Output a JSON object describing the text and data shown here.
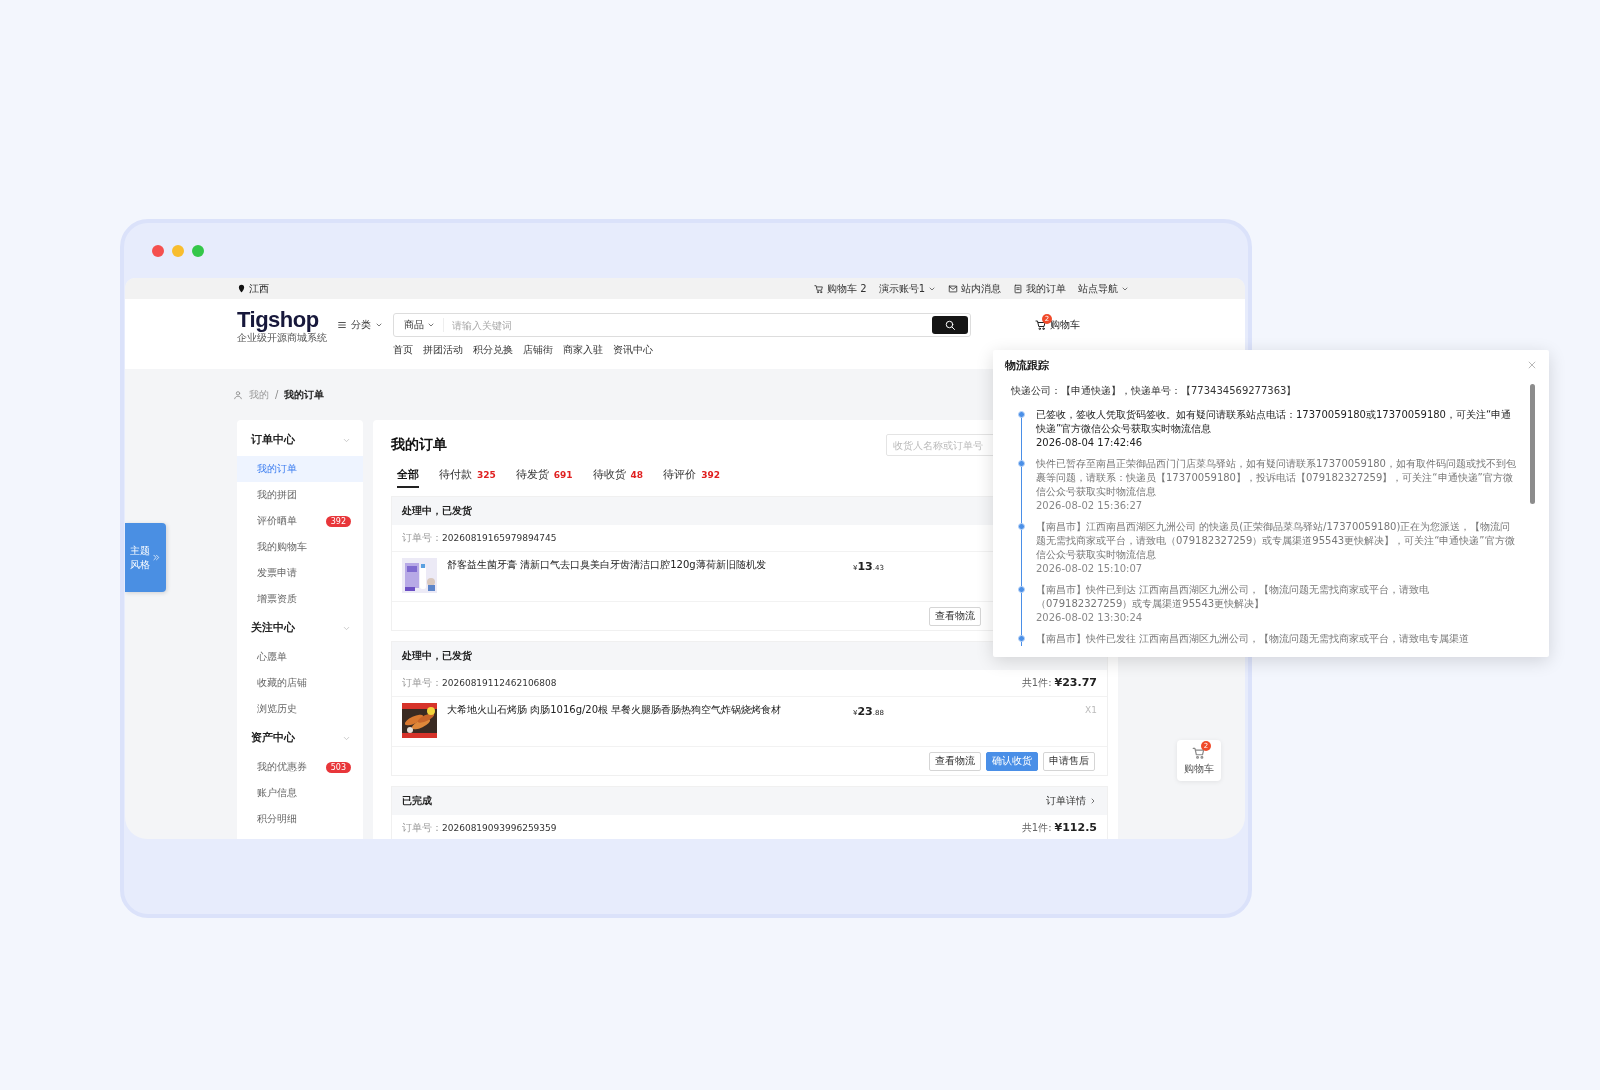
{
  "window_controls": [
    {
      "color": "#f5504e"
    },
    {
      "color": "#f8bd2e"
    },
    {
      "color": "#34c749"
    }
  ],
  "top_bar": {
    "location": "江西",
    "links": [
      {
        "kind": "cart",
        "label": "购物车 2",
        "dropdown": false
      },
      {
        "kind": "account",
        "label": "演示账号1",
        "dropdown": true
      },
      {
        "kind": "messages",
        "label": "站内消息",
        "dropdown": false
      },
      {
        "kind": "orders",
        "label": "我的订单",
        "dropdown": false
      },
      {
        "kind": "navigation",
        "label": "站点导航",
        "dropdown": true
      }
    ]
  },
  "header": {
    "logo": "Tigshop",
    "tagline": "企业级开源商城系统",
    "category": "分类",
    "search": {
      "scope": "商品",
      "placeholder": "请输入关键词"
    },
    "cart": {
      "label": "购物车",
      "count": "2"
    },
    "nav": [
      "首页",
      "拼团活动",
      "积分兑换",
      "店铺街",
      "商家入驻",
      "资讯中心"
    ]
  },
  "breadcrumb": {
    "items": [
      "我的",
      "我的订单"
    ],
    "separator": "/"
  },
  "sidebar": [
    {
      "title": "订单中心",
      "expanded": true,
      "items": [
        {
          "label": "我的订单",
          "selected": true
        },
        {
          "label": "我的拼团",
          "selected": false
        },
        {
          "label": "评价晒单",
          "selected": false,
          "badge": "392"
        },
        {
          "label": "我的购物车",
          "selected": false
        },
        {
          "label": "发票申请",
          "selected": false
        },
        {
          "label": "增票资质",
          "selected": false
        }
      ]
    },
    {
      "title": "关注中心",
      "expanded": true,
      "items": [
        {
          "label": "心愿单",
          "selected": false
        },
        {
          "label": "收藏的店铺",
          "selected": false
        },
        {
          "label": "浏览历史",
          "selected": false
        }
      ]
    },
    {
      "title": "资产中心",
      "expanded": true,
      "items": [
        {
          "label": "我的优惠券",
          "selected": false,
          "badge": "503"
        },
        {
          "label": "账户信息",
          "selected": false
        },
        {
          "label": "积分明细",
          "selected": false
        }
      ]
    }
  ],
  "orders": {
    "title": "我的订单",
    "search_placeholder": "收货人名称或订单号",
    "tabs": [
      {
        "label": "全部",
        "selected": true
      },
      {
        "label": "待付款",
        "count": "325",
        "selected": false
      },
      {
        "label": "待发货",
        "count": "691",
        "selected": false
      },
      {
        "label": "待收货",
        "count": "48",
        "selected": false
      },
      {
        "label": "待评价",
        "count": "392",
        "selected": false
      }
    ],
    "list": [
      {
        "status": "处理中，已发货",
        "order_label": "订单号：",
        "order_no": "20260819165979894745",
        "items": [
          {
            "name": "舒客益生菌牙膏 清新口气去口臭美白牙齿清洁口腔120g薄荷新旧随机发",
            "currency": "¥",
            "price_main": "13",
            "price_fraction": ".43"
          }
        ],
        "actions": [
          {
            "label": "查看物流",
            "primary": false
          }
        ]
      },
      {
        "status": "处理中，已发货",
        "order_label": "订单号：",
        "order_no": "20260819112462106808",
        "total_label": "共1件:",
        "total": "¥23.77",
        "items": [
          {
            "name": "大希地火山石烤肠 肉肠1016g/20根 早餐火腿肠香肠热狗空气炸锅烧烤食材",
            "currency": "¥",
            "price_main": "23",
            "price_fraction": ".88",
            "qty": "X1"
          }
        ],
        "actions": [
          {
            "label": "查看物流",
            "primary": false
          },
          {
            "label": "确认收货",
            "primary": true
          },
          {
            "label": "申请售后",
            "primary": false
          }
        ]
      },
      {
        "status": "已完成",
        "detail_link": "订单详情",
        "order_label": "订单号：",
        "order_no": "20260819093996259359",
        "total_label": "共1件:",
        "total": "¥112.5"
      }
    ]
  },
  "theme_button": {
    "label": "主题风格"
  },
  "float_cart": {
    "label": "购物车",
    "count": "2"
  },
  "logistics_dialog": {
    "title": "物流跟踪",
    "carrier_info": "快递公司：【申通快递】，快递单号：【773434569277363】",
    "events": [
      {
        "text": "已签收，签收人凭取货码签收。如有疑问请联系站点电话：17370059180或17370059180，可关注“申通快递”官方微信公众号获取实时物流信息",
        "time": "2026-08-04 17:42:46",
        "latest": true
      },
      {
        "text": "快件已暂存至南昌正荣御品西门门店菜鸟驿站，如有疑问请联系17370059180，如有取件码问题或找不到包裹等问题，请联系：快递员【17370059180】，投诉电话【079182327259】，可关注“申通快递”官方微信公众号获取实时物流信息",
        "time": "2026-08-02 15:36:27",
        "latest": false
      },
      {
        "text": "【南昌市】江西南昌西湖区九洲公司 的快递员(正荣御品菜鸟驿站/17370059180)正在为您派送，【物流问题无需找商家或平台，请致电（079182327259）或专属渠道95543更快解决】，可关注“申通快递”官方微信公众号获取实时物流信息",
        "time": "2026-08-02 15:10:07",
        "latest": false
      },
      {
        "text": "【南昌市】快件已到达 江西南昌西湖区九洲公司，【物流问题无需找商家或平台，请致电（079182327259）或专属渠道95543更快解决】",
        "time": "2026-08-02 13:30:24",
        "latest": false
      },
      {
        "text": "【南昌市】快件已发往 江西南昌西湖区九洲公司，【物流问题无需找商家或平台，请致电专属渠道",
        "latest": false
      }
    ]
  }
}
